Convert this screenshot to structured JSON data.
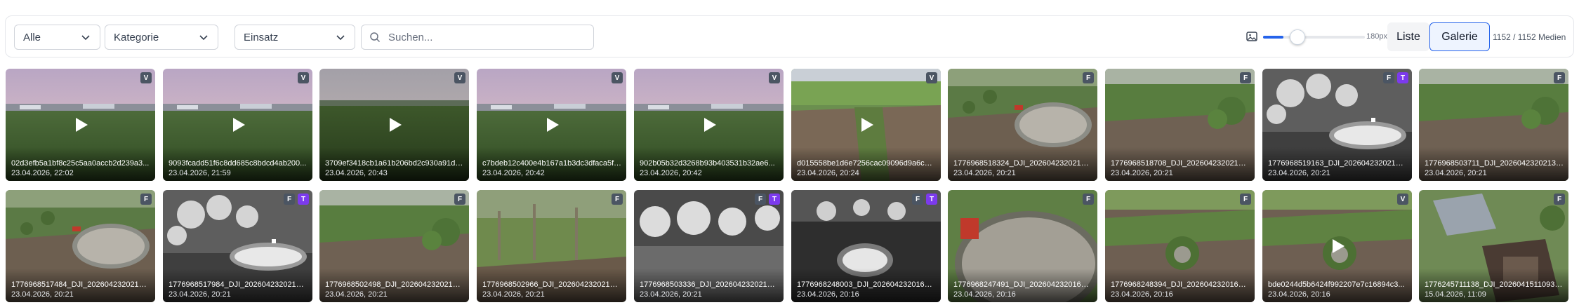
{
  "filters": {
    "type": {
      "value": "Alle"
    },
    "category": {
      "value": "Kategorie"
    },
    "mission": {
      "value": "Einsatz"
    },
    "search": {
      "placeholder": "Suchen...",
      "value": ""
    }
  },
  "size_slider": {
    "label": "180px",
    "fraction": 0.2
  },
  "views": {
    "list_label": "Liste",
    "gallery_label": "Galerie",
    "active": "gallery"
  },
  "media_count": "1152 / 1152 Medien",
  "colors": {
    "accent": "#2563eb",
    "thermal_badge": "#7c3aed",
    "badge": "#4b5563"
  },
  "tiles": [
    {
      "name": "02d3efb5a1bf8c25c5aa0accb2d239a3...",
      "date": "23.04.2026, 22:02",
      "badges": [
        "V"
      ],
      "video": true,
      "scene": "sunset"
    },
    {
      "name": "9093fcadd51f6c8dd685c8bdcd4ab200...",
      "date": "23.04.2026, 21:59",
      "badges": [
        "V"
      ],
      "video": true,
      "scene": "sunset"
    },
    {
      "name": "3709ef3418cb1a61b206bd2c930a91d8...",
      "date": "23.04.2026, 20:43",
      "badges": [
        "V"
      ],
      "video": true,
      "scene": "field-dusk"
    },
    {
      "name": "c7bdeb12c400e4b167a1b3dc3dfaca5ffa...",
      "date": "23.04.2026, 20:42",
      "badges": [
        "V"
      ],
      "video": true,
      "scene": "sunset"
    },
    {
      "name": "902b05b32d3268b93b403531b32ae6...",
      "date": "23.04.2026, 20:42",
      "badges": [
        "V"
      ],
      "video": true,
      "scene": "sunset"
    },
    {
      "name": "d015558be1d6e7256cac09096d9a6c51...",
      "date": "23.04.2026, 20:24",
      "badges": [
        "V"
      ],
      "video": true,
      "scene": "field"
    },
    {
      "name": "1776968518324_DJI_20260423202139...",
      "date": "23.04.2026, 20:21",
      "badges": [
        "F"
      ],
      "video": false,
      "scene": "pond"
    },
    {
      "name": "1776968518708_DJI_20260423202139...",
      "date": "23.04.2026, 20:21",
      "badges": [
        "F"
      ],
      "video": false,
      "scene": "field-trees"
    },
    {
      "name": "1776968519163_DJI_20260423202139_...",
      "date": "23.04.2026, 20:21",
      "badges": [
        "F",
        "T"
      ],
      "video": false,
      "scene": "thermal"
    },
    {
      "name": "1776968503711_DJI_20260423202132_...",
      "date": "23.04.2026, 20:21",
      "badges": [
        "F"
      ],
      "video": false,
      "scene": "field-trees"
    },
    {
      "name": "1776968517484_DJI_20260423202132...",
      "date": "23.04.2026, 20:21",
      "badges": [
        "F"
      ],
      "video": false,
      "scene": "pond"
    },
    {
      "name": "1776968517984_DJI_20260423202133...",
      "date": "23.04.2026, 20:21",
      "badges": [
        "F",
        "T"
      ],
      "video": false,
      "scene": "thermal"
    },
    {
      "name": "1776968502498_DJI_20260423202122...",
      "date": "23.04.2026, 20:21",
      "badges": [
        "F"
      ],
      "video": false,
      "scene": "field-trees"
    },
    {
      "name": "1776968502966_DJI_20260423202122...",
      "date": "23.04.2026, 20:21",
      "badges": [
        "F"
      ],
      "video": false,
      "scene": "trees"
    },
    {
      "name": "1776968503336_DJI_20260423202123...",
      "date": "23.04.2026, 20:21",
      "badges": [
        "F",
        "T"
      ],
      "video": false,
      "scene": "thermal-trees"
    },
    {
      "name": "1776968248003_DJI_20260423201651...",
      "date": "23.04.2026, 20:16",
      "badges": [
        "F",
        "T"
      ],
      "video": false,
      "scene": "thermal-dark"
    },
    {
      "name": "1776968247491_DJI_20260423201650...",
      "date": "23.04.2026, 20:16",
      "badges": [
        "F"
      ],
      "video": false,
      "scene": "pond-close"
    },
    {
      "name": "1776968248394_DJI_20260423201651...",
      "date": "23.04.2026, 20:16",
      "badges": [
        "F"
      ],
      "video": false,
      "scene": "plowed"
    },
    {
      "name": "bde0244d5b6424f992207e7c16894c3...",
      "date": "23.04.2026, 20:16",
      "badges": [
        "V"
      ],
      "video": true,
      "scene": "plowed"
    },
    {
      "name": "1776245711138_DJI_20260415110935_0...",
      "date": "15.04.2026, 11:09",
      "badges": [
        "F"
      ],
      "video": false,
      "scene": "house"
    }
  ]
}
